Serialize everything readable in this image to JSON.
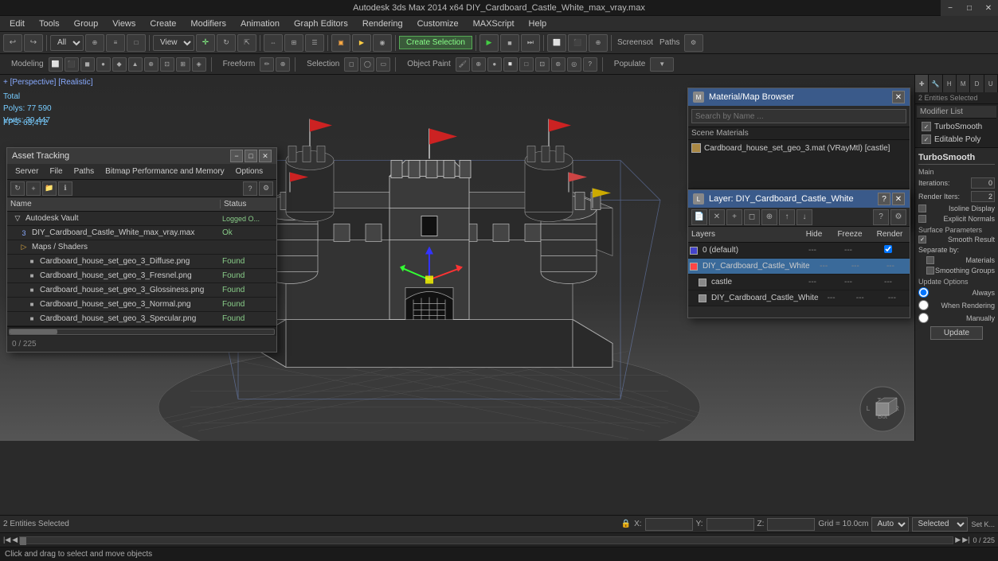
{
  "app": {
    "title": "Autodesk 3ds Max 2014 x64     DIY_Cardboard_Castle_White_max_vray.max",
    "win_min": "−",
    "win_max": "□",
    "win_close": "✕"
  },
  "menu": {
    "items": [
      "Edit",
      "Tools",
      "Group",
      "Views",
      "Create",
      "Modifiers",
      "Animation",
      "Graph Editors",
      "Rendering",
      "Customize",
      "MAXScript",
      "Help"
    ]
  },
  "toolbar1": {
    "select_label": "All",
    "view_label": "View",
    "create_selection_label": "Create Selection",
    "screenshot_label": "Screensot",
    "paths_label": "Paths"
  },
  "toolbar2": {
    "groups": [
      "Modeling",
      "Freeform",
      "Selection",
      "Object Paint",
      "Populate"
    ]
  },
  "viewport": {
    "label": "+ [Perspective] [Realistic]",
    "total_label": "Total",
    "polys_label": "Polys:",
    "polys_val": "77 590",
    "verts_label": "Verts:",
    "verts_val": "39 447",
    "fps_label": "FPS:",
    "fps_val": "63,472"
  },
  "right_panel": {
    "entities_selected": "2 Entities Selected",
    "modifier_list_title": "Modifier List",
    "modifiers": [
      {
        "name": "TurboSmooth",
        "checked": true
      },
      {
        "name": "Editable Poly",
        "checked": true
      }
    ],
    "turbosmooth": {
      "title": "TurboSmooth",
      "main_label": "Main",
      "iterations_label": "Iterations:",
      "iterations_val": "0",
      "render_iters_label": "Render Iters:",
      "render_iters_val": "2",
      "isoline_display": "Isoline Display",
      "explicit_normals": "Explicit Normals",
      "surface_params": "Surface Parameters",
      "smooth_result": "Smooth Result",
      "separate_by": "Separate by:",
      "materials": "Materials",
      "smoothing_groups": "Smoothing Groups",
      "update_options": "Update Options",
      "always": "Always",
      "when_rendering": "When Rendering",
      "manually": "Manually",
      "update_btn": "Update"
    }
  },
  "asset_tracking": {
    "title": "Asset Tracking",
    "menus": [
      "Server",
      "File",
      "Paths",
      "Bitmap Performance and Memory",
      "Options"
    ],
    "col_name": "Name",
    "col_status": "Status",
    "items": [
      {
        "level": 0,
        "type": "vault",
        "name": "Autodesk Vault",
        "status": "Logged O..."
      },
      {
        "level": 1,
        "type": "max",
        "name": "DIY_Cardboard_Castle_White_max_vray.max",
        "status": "Ok"
      },
      {
        "level": 1,
        "type": "folder",
        "name": "Maps / Shaders",
        "status": ""
      },
      {
        "level": 2,
        "type": "bitmap",
        "name": "Cardboard_house_set_geo_3_Diffuse.png",
        "status": "Found"
      },
      {
        "level": 2,
        "type": "bitmap",
        "name": "Cardboard_house_set_geo_3_Fresnel.png",
        "status": "Found"
      },
      {
        "level": 2,
        "type": "bitmap",
        "name": "Cardboard_house_set_geo_3_Glossiness.png",
        "status": "Found"
      },
      {
        "level": 2,
        "type": "bitmap",
        "name": "Cardboard_house_set_geo_3_Normal.png",
        "status": "Found"
      },
      {
        "level": 2,
        "type": "bitmap",
        "name": "Cardboard_house_set_geo_3_Specular.png",
        "status": "Found"
      }
    ],
    "footer": "0 / 225"
  },
  "material_browser": {
    "title": "Material/Map Browser",
    "search_placeholder": "Search by Name ...",
    "section_label": "Scene Materials",
    "items": [
      {
        "name": "Cardboard_house_set_geo_3.mat (VRayMtl) [castle]",
        "color": "#aa8844"
      }
    ]
  },
  "layer_dialog": {
    "title": "Layer: DIY_Cardboard_Castle_White",
    "col_layers": "Layers",
    "col_hide": "Hide",
    "col_freeze": "Freeze",
    "col_render": "Render",
    "rows": [
      {
        "name": "0 (default)",
        "hide": "---",
        "freeze": "---",
        "render": "---",
        "color": "#4444cc",
        "selected": false,
        "has_checkbox": true
      },
      {
        "name": "DIY_Cardboard_Castle_White",
        "hide": "---",
        "freeze": "---",
        "render": "---",
        "color": "#ff4444",
        "selected": true
      },
      {
        "name": "castle",
        "hide": "---",
        "freeze": "---",
        "render": "---",
        "color": "#aaaaaa",
        "selected": false,
        "indent": true
      },
      {
        "name": "DIY_Cardboard_Castle_White",
        "hide": "---",
        "freeze": "---",
        "render": "---",
        "color": "#aaaaaa",
        "selected": false,
        "indent": true
      }
    ]
  },
  "status_bar": {
    "entities_label": "2 Entities Selected",
    "grid_label": "Grid = 10.0cm",
    "auto_label": "Auto",
    "selected_label": "Selected",
    "x_label": "X:",
    "y_label": "Y:",
    "z_label": "Z:",
    "setkey_label": "Set K..."
  },
  "timeline": {
    "frame_label": "0 / 225"
  },
  "cmd_bar": {
    "message": "Click and drag to select and move objects"
  },
  "bottom_status": {
    "entities": "2 Entities Selected"
  }
}
